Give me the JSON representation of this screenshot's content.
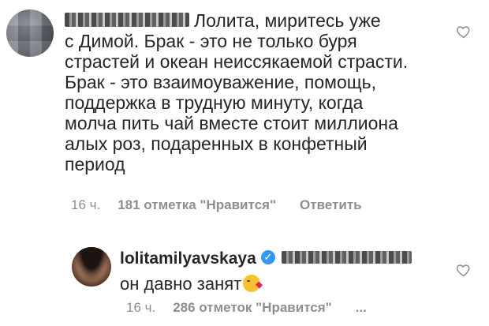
{
  "comment_main": {
    "text_lines": [
      "Лолита, миритесь уже",
      "с Димой. Брак - это не только буря",
      "страстей и океан неиссякаемой страсти.",
      "Брак - это взаимоуважение, помощь,",
      "поддержка в трудную минуту, когда",
      "молча пить чай вместе стоит миллиона",
      "алых роз, подаренных в конфетный",
      "период"
    ],
    "time": "16 ч.",
    "likes": "181 отметка \"Нравится\"",
    "reply": "Ответить"
  },
  "comment_reply": {
    "username": "lolitamilyavskaya",
    "verified_glyph": "✓",
    "text": "он давно занят",
    "time": "16 ч.",
    "likes": "286 отметок \"Нравится\"",
    "more": "..."
  },
  "icons": {
    "like": "heart-outline-icon",
    "verified": "verified-badge-icon",
    "emoji": "kissing-face-emoji"
  },
  "colors": {
    "text": "#262626",
    "meta": "#8e8e8e",
    "verified": "#3897f0",
    "background": "#ffffff"
  }
}
